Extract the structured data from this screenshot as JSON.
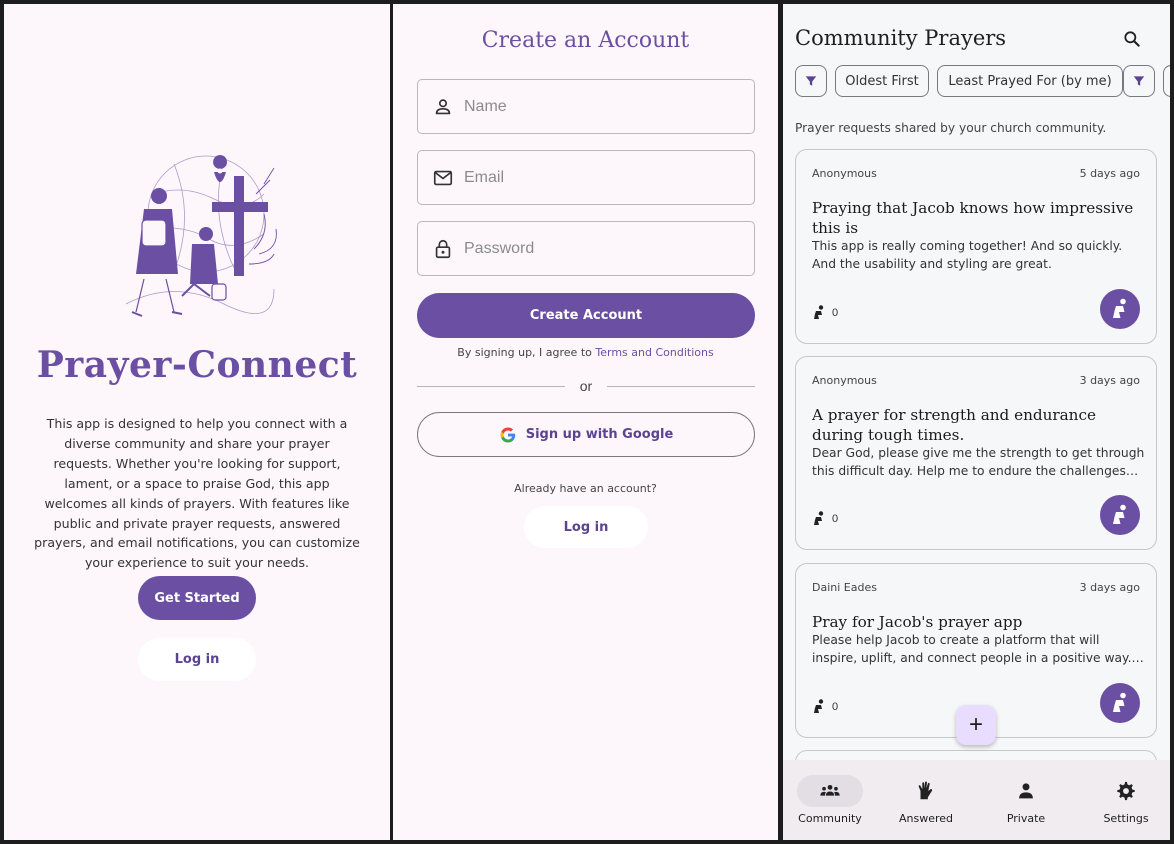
{
  "colors": {
    "primary": "#6a4fa3",
    "on_primary": "#ffffff",
    "background": "#fdf7fb",
    "feed_background": "#f5f7f8",
    "fab": "#e9ddff",
    "nav_bar": "#f1ecf0"
  },
  "welcome": {
    "title": "Prayer-Connect",
    "description": "This app is designed to help you connect with a diverse community and share your prayer requests. Whether you're looking for support, lament, or a space to praise God, this app welcomes all kinds of prayers. With features like public and private prayer requests, answered prayers, and email notifications, you can customize your experience to suit your needs.",
    "get_started_label": "Get Started",
    "login_label": "Log in"
  },
  "signup": {
    "title": "Create an Account",
    "name_placeholder": "Name",
    "email_placeholder": "Email",
    "password_placeholder": "Password",
    "create_label": "Create Account",
    "terms_prefix": "By signing up, I agree to",
    "terms_link": "Terms and Conditions",
    "or_label": "or",
    "google_label": "Sign up with Google",
    "already_label": "Already have an account?",
    "login_label": "Log in"
  },
  "feed": {
    "title": "Community Prayers",
    "chips": {
      "oldest": "Oldest First",
      "least_prayed": "Least Prayed For (by me)"
    },
    "subtitle": "Prayer requests shared by your church community.",
    "cards": [
      {
        "author": "Anonymous",
        "time": "5 days ago",
        "title": "Praying that Jacob knows how impressive this is",
        "body": "This app is really coming together! And so quickly. And the usability and styling are great.",
        "count": "0"
      },
      {
        "author": "Anonymous",
        "time": "3 days ago",
        "title": "A prayer for strength and endurance during tough times.",
        "body": "Dear God, please give me the strength to get through this difficult day. Help me to endure the challenges that lie ahead and give me peace.",
        "count": "0"
      },
      {
        "author": "Daini Eades",
        "time": "3 days ago",
        "title": "Pray for Jacob's prayer app",
        "body": "Please help Jacob to create a platform that will inspire, uplift, and connect people in a positive way. Please bless this work.",
        "count": "0"
      }
    ],
    "fab_label": "+",
    "nav": [
      {
        "label": "Community",
        "icon": "groups-icon"
      },
      {
        "label": "Answered",
        "icon": "raised-hands-icon"
      },
      {
        "label": "Private",
        "icon": "person-icon"
      },
      {
        "label": "Settings",
        "icon": "gear-icon"
      }
    ]
  }
}
